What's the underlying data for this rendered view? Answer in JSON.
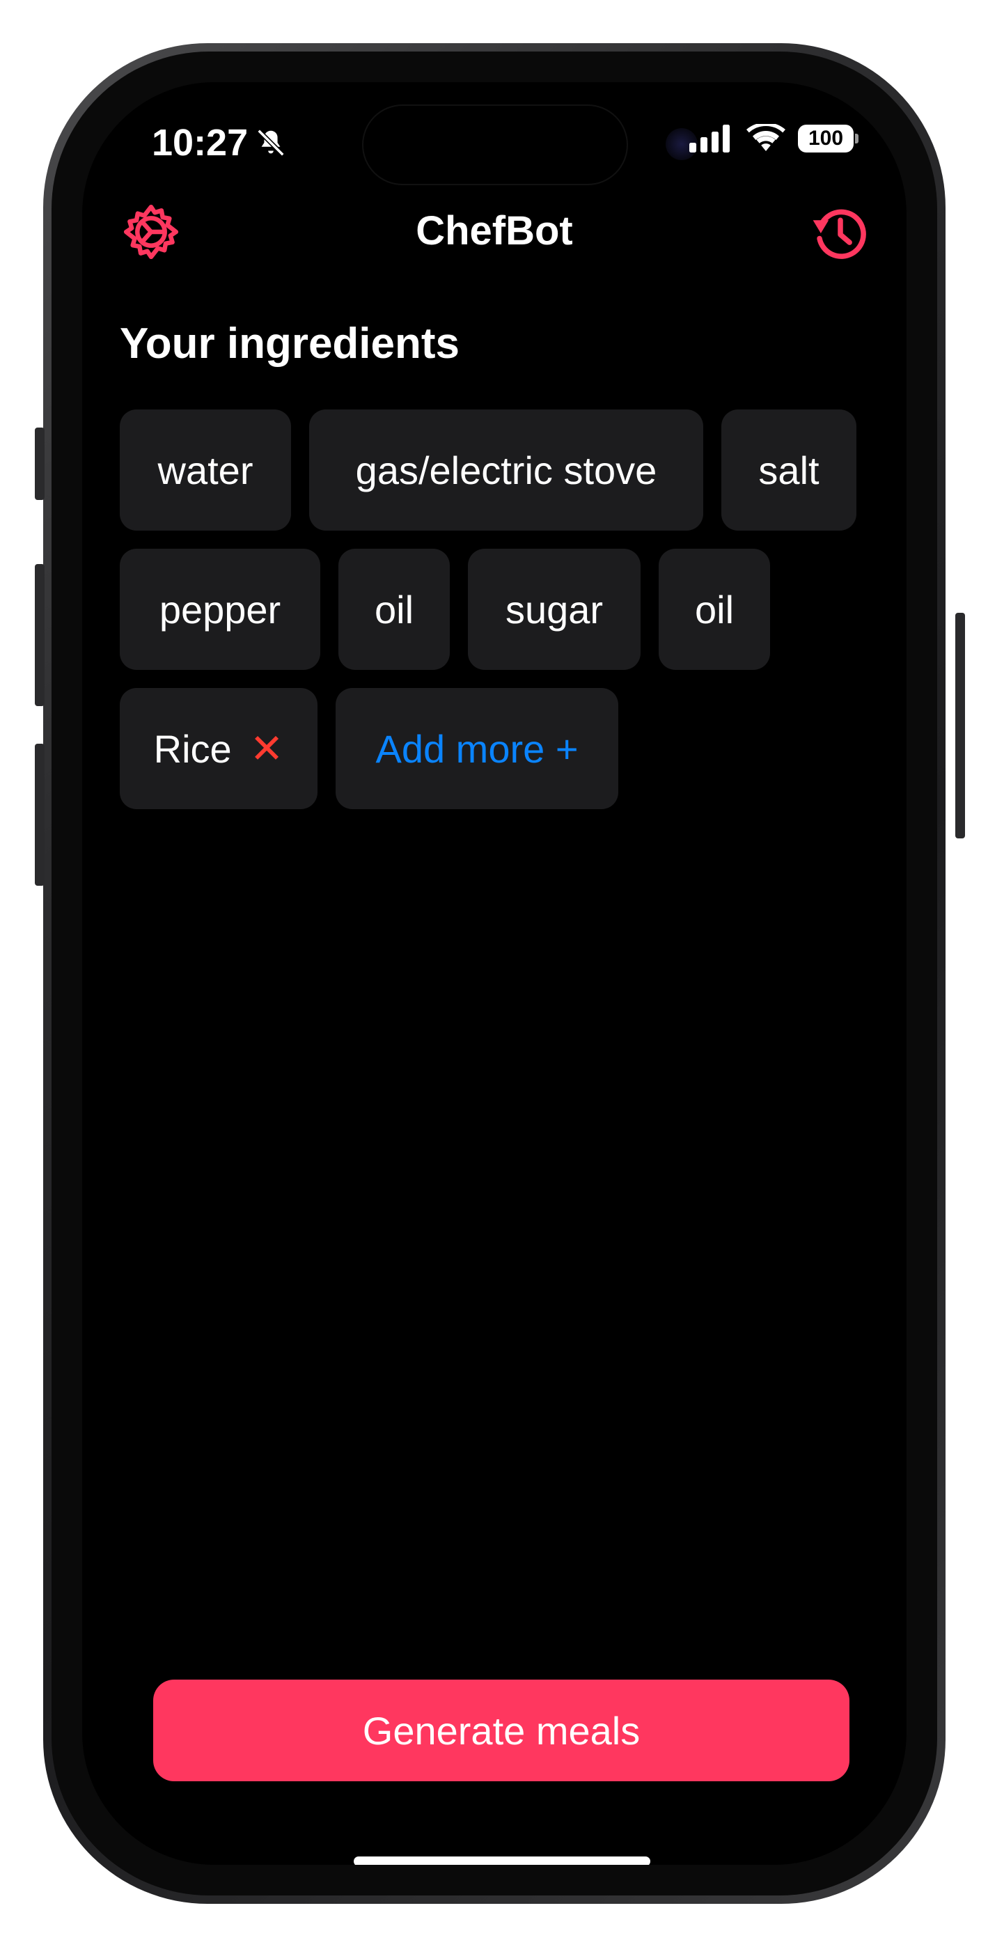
{
  "status_bar": {
    "time": "10:27",
    "battery": "100",
    "icons": [
      "bell-slash-icon",
      "signal-icon",
      "wifi-icon",
      "battery-icon"
    ]
  },
  "nav": {
    "title": "ChefBot",
    "left_icon": "settings-gear-icon",
    "right_icon": "history-icon"
  },
  "section": {
    "title": "Your ingredients"
  },
  "ingredients": [
    "water",
    "gas/electric stove",
    "salt",
    "pepper",
    "oil",
    "sugar",
    "oil",
    "Rice"
  ],
  "removable_marker": "✕",
  "add_more_label": "Add more +",
  "generate_label": "Generate meals",
  "colors": {
    "accent": "#ff375f",
    "link": "#0a84ff",
    "remove": "#ff3b30",
    "chip_bg": "#1c1c1e",
    "background": "#000000"
  }
}
